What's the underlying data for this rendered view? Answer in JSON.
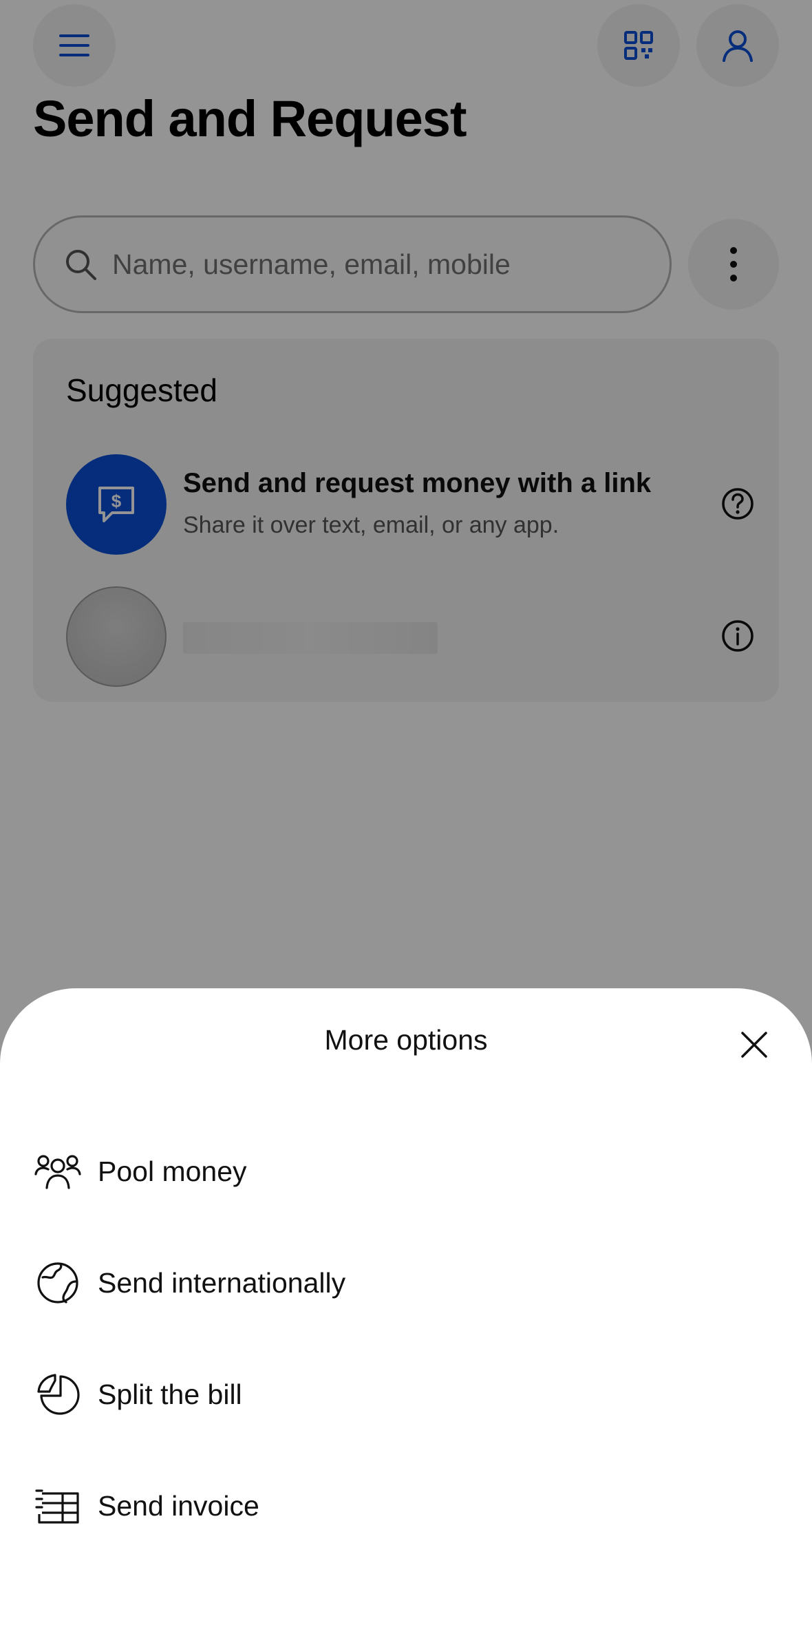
{
  "header": {
    "menu_icon": "hamburger-menu-icon",
    "qr_icon": "qr-code-icon",
    "profile_icon": "profile-icon",
    "title": "Send and Request"
  },
  "search": {
    "placeholder": "Name, username, email, mobile"
  },
  "suggested": {
    "title": "Suggested",
    "link_item": {
      "title": "Send and request money with a link",
      "subtitle": "Share it over text, email, or any app."
    }
  },
  "sheet": {
    "title": "More options",
    "options": [
      {
        "label": "Pool money",
        "icon": "people-group-icon"
      },
      {
        "label": "Send internationally",
        "icon": "globe-icon"
      },
      {
        "label": "Split the bill",
        "icon": "pie-chart-icon"
      },
      {
        "label": "Send invoice",
        "icon": "invoice-icon"
      }
    ]
  },
  "colors": {
    "brand_blue": "#0a4fd6",
    "overlay": "rgba(0,0,0,0.42)"
  }
}
